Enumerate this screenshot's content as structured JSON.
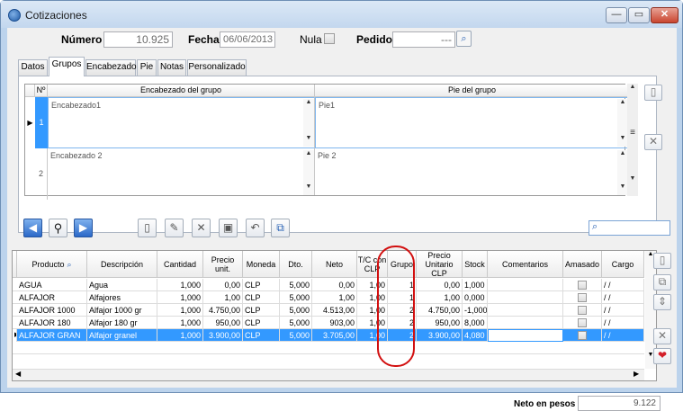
{
  "window": {
    "title": "Cotizaciones",
    "minimize": "—",
    "maximize": "▭",
    "close": "✕"
  },
  "header": {
    "numero_label": "Número",
    "numero_value": "10.925",
    "fecha_label": "Fecha",
    "fecha_value": "06/06/2013",
    "nula_label": "Nula",
    "pedido_label": "Pedido",
    "pedido_value": "---"
  },
  "tabs": [
    "Datos",
    "Grupos",
    "Encabezado",
    "Pie",
    "Notas",
    "Personalizado"
  ],
  "active_tab": "Grupos",
  "groups_grid": {
    "headers": [
      "Nº",
      "Encabezado del grupo",
      "Pie del grupo"
    ],
    "rows": [
      {
        "n": "1",
        "header": "Encabezado1",
        "footer": "Pie1"
      },
      {
        "n": "2",
        "header": "Encabezado 2",
        "footer": "Pie 2"
      }
    ]
  },
  "products_grid": {
    "headers": [
      "Producto",
      "Descripción",
      "Cantidad",
      "Precio unit.",
      "Moneda",
      "Dto.",
      "Neto",
      "T/C con CLP",
      "Grupo",
      "Precio Unitario CLP",
      "Stock",
      "Comentarios",
      "Amasado",
      "Cargo"
    ],
    "rows": [
      {
        "producto": "AGUA",
        "descripcion": "Agua",
        "cantidad": "1,000",
        "precio": "0,00",
        "moneda": "CLP",
        "dto": "5,000",
        "neto": "0,00",
        "tc": "1,00",
        "grupo": "1",
        "precio_clp": "0,00",
        "stock": "1,000",
        "comentarios": "",
        "cargo": "/ /"
      },
      {
        "producto": "ALFAJOR",
        "descripcion": "Alfajores",
        "cantidad": "1,000",
        "precio": "1,00",
        "moneda": "CLP",
        "dto": "5,000",
        "neto": "1,00",
        "tc": "1,00",
        "grupo": "1",
        "precio_clp": "1,00",
        "stock": "0,000",
        "comentarios": "",
        "cargo": "/ /"
      },
      {
        "producto": "ALFAJOR 1000",
        "descripcion": "Alfajor 1000 gr",
        "cantidad": "1,000",
        "precio": "4.750,00",
        "moneda": "CLP",
        "dto": "5,000",
        "neto": "4.513,00",
        "tc": "1,00",
        "grupo": "2",
        "precio_clp": "4.750,00",
        "stock": "-1,000",
        "comentarios": "",
        "cargo": "/ /"
      },
      {
        "producto": "ALFAJOR 180",
        "descripcion": "Alfajor 180 gr",
        "cantidad": "1,000",
        "precio": "950,00",
        "moneda": "CLP",
        "dto": "5,000",
        "neto": "903,00",
        "tc": "1,00",
        "grupo": "2",
        "precio_clp": "950,00",
        "stock": "8,000",
        "comentarios": "",
        "cargo": "/ /"
      },
      {
        "producto": "ALFAJOR GRAN",
        "descripcion": "Alfajor granel",
        "cantidad": "1,000",
        "precio": "3.900,00",
        "moneda": "CLP",
        "dto": "5,000",
        "neto": "3.705,00",
        "tc": "1,00",
        "grupo": "2",
        "precio_clp": "3.900,00",
        "stock": "4,080",
        "comentarios": "",
        "cargo": "/ /"
      }
    ],
    "selected_row": 4
  },
  "footer": {
    "neto_label": "Neto en pesos",
    "neto_value": "9.122"
  },
  "colors": {
    "selection": "#3399ff",
    "highlight_circle": "#d21010"
  }
}
